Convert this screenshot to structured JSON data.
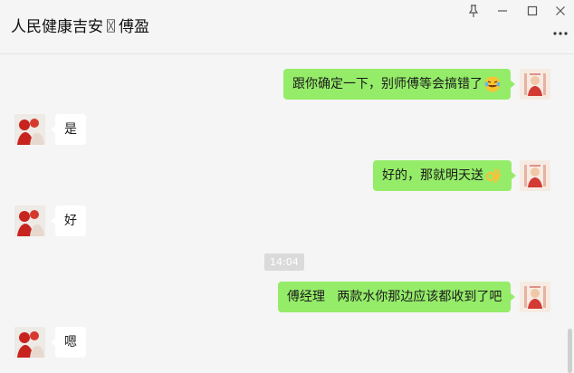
{
  "window": {
    "title": "人民健康吉安\u0000傅盈",
    "title_display": "人民健康吉安〿傅盈",
    "controls": [
      "pin-icon",
      "minimize-icon",
      "maximize-icon",
      "close-icon"
    ],
    "more_icon": "more-icon"
  },
  "messages": [
    {
      "from": "me",
      "text": "跟你确定一下，别师傅等会搞错了",
      "emoji": "laughing-tears-emoji"
    },
    {
      "from": "other",
      "text": "是"
    },
    {
      "from": "me",
      "text": "好的，那就明天送",
      "emoji": "ok-hand-emoji"
    },
    {
      "from": "other",
      "text": "好"
    },
    {
      "from": "me",
      "text": "傅经理   两款水你那边应该都收到了吧"
    },
    {
      "from": "other",
      "text": "嗯"
    }
  ],
  "timestamp": "14:04",
  "colors": {
    "background": "#f5f5f5",
    "my_bubble": "#95ec69",
    "other_bubble": "#ffffff",
    "timestamp_bg": "#dadada"
  }
}
